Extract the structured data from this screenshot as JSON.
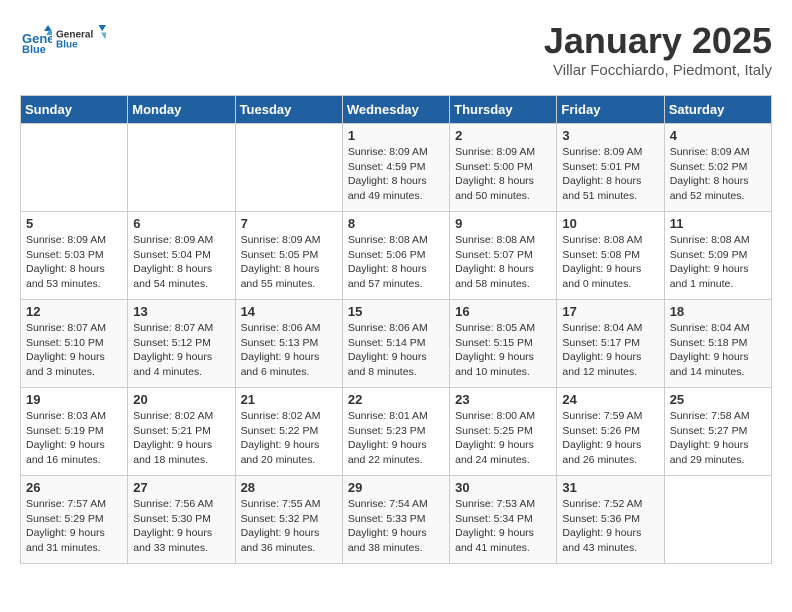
{
  "header": {
    "logo_line1": "General",
    "logo_line2": "Blue",
    "month": "January 2025",
    "location": "Villar Focchiardo, Piedmont, Italy"
  },
  "weekdays": [
    "Sunday",
    "Monday",
    "Tuesday",
    "Wednesday",
    "Thursday",
    "Friday",
    "Saturday"
  ],
  "weeks": [
    [
      {
        "day": "",
        "info": ""
      },
      {
        "day": "",
        "info": ""
      },
      {
        "day": "",
        "info": ""
      },
      {
        "day": "1",
        "info": "Sunrise: 8:09 AM\nSunset: 4:59 PM\nDaylight: 8 hours\nand 49 minutes."
      },
      {
        "day": "2",
        "info": "Sunrise: 8:09 AM\nSunset: 5:00 PM\nDaylight: 8 hours\nand 50 minutes."
      },
      {
        "day": "3",
        "info": "Sunrise: 8:09 AM\nSunset: 5:01 PM\nDaylight: 8 hours\nand 51 minutes."
      },
      {
        "day": "4",
        "info": "Sunrise: 8:09 AM\nSunset: 5:02 PM\nDaylight: 8 hours\nand 52 minutes."
      }
    ],
    [
      {
        "day": "5",
        "info": "Sunrise: 8:09 AM\nSunset: 5:03 PM\nDaylight: 8 hours\nand 53 minutes."
      },
      {
        "day": "6",
        "info": "Sunrise: 8:09 AM\nSunset: 5:04 PM\nDaylight: 8 hours\nand 54 minutes."
      },
      {
        "day": "7",
        "info": "Sunrise: 8:09 AM\nSunset: 5:05 PM\nDaylight: 8 hours\nand 55 minutes."
      },
      {
        "day": "8",
        "info": "Sunrise: 8:08 AM\nSunset: 5:06 PM\nDaylight: 8 hours\nand 57 minutes."
      },
      {
        "day": "9",
        "info": "Sunrise: 8:08 AM\nSunset: 5:07 PM\nDaylight: 8 hours\nand 58 minutes."
      },
      {
        "day": "10",
        "info": "Sunrise: 8:08 AM\nSunset: 5:08 PM\nDaylight: 9 hours\nand 0 minutes."
      },
      {
        "day": "11",
        "info": "Sunrise: 8:08 AM\nSunset: 5:09 PM\nDaylight: 9 hours\nand 1 minute."
      }
    ],
    [
      {
        "day": "12",
        "info": "Sunrise: 8:07 AM\nSunset: 5:10 PM\nDaylight: 9 hours\nand 3 minutes."
      },
      {
        "day": "13",
        "info": "Sunrise: 8:07 AM\nSunset: 5:12 PM\nDaylight: 9 hours\nand 4 minutes."
      },
      {
        "day": "14",
        "info": "Sunrise: 8:06 AM\nSunset: 5:13 PM\nDaylight: 9 hours\nand 6 minutes."
      },
      {
        "day": "15",
        "info": "Sunrise: 8:06 AM\nSunset: 5:14 PM\nDaylight: 9 hours\nand 8 minutes."
      },
      {
        "day": "16",
        "info": "Sunrise: 8:05 AM\nSunset: 5:15 PM\nDaylight: 9 hours\nand 10 minutes."
      },
      {
        "day": "17",
        "info": "Sunrise: 8:04 AM\nSunset: 5:17 PM\nDaylight: 9 hours\nand 12 minutes."
      },
      {
        "day": "18",
        "info": "Sunrise: 8:04 AM\nSunset: 5:18 PM\nDaylight: 9 hours\nand 14 minutes."
      }
    ],
    [
      {
        "day": "19",
        "info": "Sunrise: 8:03 AM\nSunset: 5:19 PM\nDaylight: 9 hours\nand 16 minutes."
      },
      {
        "day": "20",
        "info": "Sunrise: 8:02 AM\nSunset: 5:21 PM\nDaylight: 9 hours\nand 18 minutes."
      },
      {
        "day": "21",
        "info": "Sunrise: 8:02 AM\nSunset: 5:22 PM\nDaylight: 9 hours\nand 20 minutes."
      },
      {
        "day": "22",
        "info": "Sunrise: 8:01 AM\nSunset: 5:23 PM\nDaylight: 9 hours\nand 22 minutes."
      },
      {
        "day": "23",
        "info": "Sunrise: 8:00 AM\nSunset: 5:25 PM\nDaylight: 9 hours\nand 24 minutes."
      },
      {
        "day": "24",
        "info": "Sunrise: 7:59 AM\nSunset: 5:26 PM\nDaylight: 9 hours\nand 26 minutes."
      },
      {
        "day": "25",
        "info": "Sunrise: 7:58 AM\nSunset: 5:27 PM\nDaylight: 9 hours\nand 29 minutes."
      }
    ],
    [
      {
        "day": "26",
        "info": "Sunrise: 7:57 AM\nSunset: 5:29 PM\nDaylight: 9 hours\nand 31 minutes."
      },
      {
        "day": "27",
        "info": "Sunrise: 7:56 AM\nSunset: 5:30 PM\nDaylight: 9 hours\nand 33 minutes."
      },
      {
        "day": "28",
        "info": "Sunrise: 7:55 AM\nSunset: 5:32 PM\nDaylight: 9 hours\nand 36 minutes."
      },
      {
        "day": "29",
        "info": "Sunrise: 7:54 AM\nSunset: 5:33 PM\nDaylight: 9 hours\nand 38 minutes."
      },
      {
        "day": "30",
        "info": "Sunrise: 7:53 AM\nSunset: 5:34 PM\nDaylight: 9 hours\nand 41 minutes."
      },
      {
        "day": "31",
        "info": "Sunrise: 7:52 AM\nSunset: 5:36 PM\nDaylight: 9 hours\nand 43 minutes."
      },
      {
        "day": "",
        "info": ""
      }
    ]
  ]
}
